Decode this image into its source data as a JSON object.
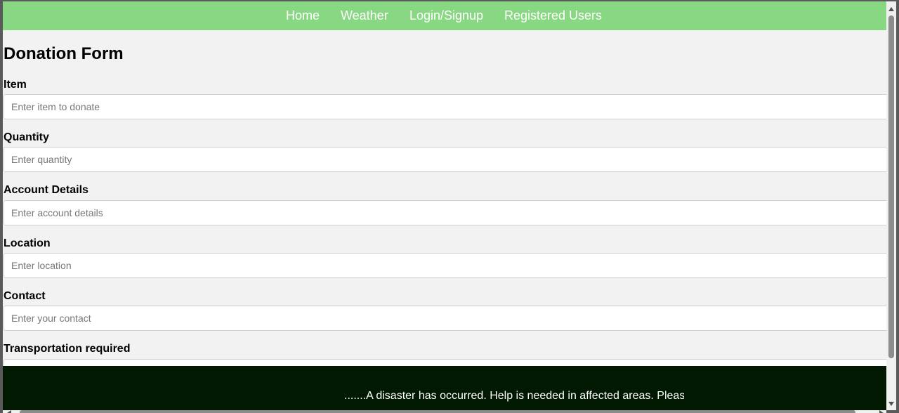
{
  "nav": {
    "items": [
      {
        "label": "Home"
      },
      {
        "label": "Weather"
      },
      {
        "label": "Login/Signup"
      },
      {
        "label": "Registered Users"
      }
    ]
  },
  "form": {
    "title": "Donation Form",
    "fields": [
      {
        "label": "Item",
        "placeholder": "Enter item to donate",
        "value": ""
      },
      {
        "label": "Quantity",
        "placeholder": "Enter quantity",
        "value": ""
      },
      {
        "label": "Account Details",
        "placeholder": "Enter account details",
        "value": ""
      },
      {
        "label": "Location",
        "placeholder": "Enter location",
        "value": ""
      },
      {
        "label": "Contact",
        "placeholder": "Enter your contact",
        "value": ""
      },
      {
        "label": "Transportation required",
        "placeholder": "",
        "value": ""
      }
    ]
  },
  "footer": {
    "marquee_text": ".......A disaster has occurred. Help is needed in affected areas. Pleas"
  },
  "colors": {
    "navbar": "#88d883",
    "page_background": "#f2f2f2",
    "footer": "#011801"
  },
  "icons": {
    "scroll_up": "triangle-up",
    "scroll_down": "triangle-down",
    "scroll_left": "triangle-left",
    "scroll_right": "triangle-right"
  }
}
